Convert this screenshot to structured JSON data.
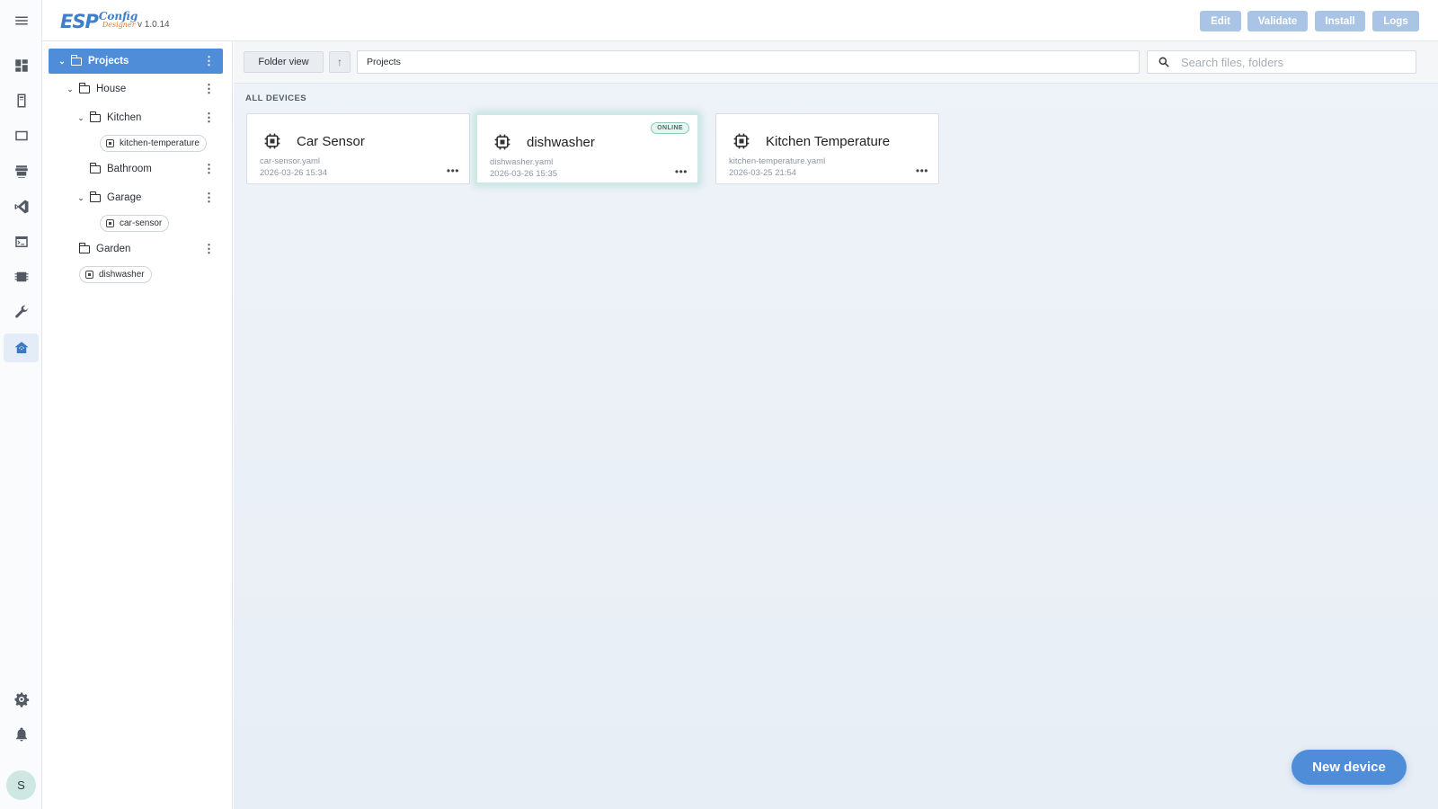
{
  "app": {
    "logo_main": "ESP",
    "logo_top": "Config",
    "logo_bottom": "Designer",
    "version": "v 1.0.14"
  },
  "header": {
    "buttons": [
      "Edit",
      "Validate",
      "Install",
      "Logs"
    ]
  },
  "rail": {
    "icons": [
      "menu-icon",
      "dashboard-icon",
      "device-icon",
      "media-icon",
      "hacs-icon",
      "vscode-icon",
      "terminal-icon",
      "esphome-icon",
      "wrench-icon",
      "home-icon",
      "settings-icon",
      "bell-icon"
    ],
    "active": "home-icon",
    "avatar_initial": "S"
  },
  "tree": {
    "root": "Projects",
    "house": "House",
    "kitchen": "Kitchen",
    "kitchen_device": "kitchen-temperature",
    "bathroom": "Bathroom",
    "garage": "Garage",
    "garage_device": "car-sensor",
    "garden": "Garden",
    "root_device": "dishwasher"
  },
  "toolbar": {
    "folder_view": "Folder view",
    "path": "Projects",
    "search_placeholder": "Search files, folders"
  },
  "main": {
    "section_label": "ALL DEVICES",
    "devices": [
      {
        "name": "Car Sensor",
        "file": "car-sensor.yaml",
        "date": "2026-03-26 15:34",
        "status": ""
      },
      {
        "name": "dishwasher",
        "file": "dishwasher.yaml",
        "date": "2026-03-26 15:35",
        "status": "ONLINE"
      },
      {
        "name": "Kitchen Temperature",
        "file": "kitchen-temperature.yaml",
        "date": "2026-03-25 21:54",
        "status": ""
      }
    ],
    "new_device": "New device"
  },
  "colors": {
    "accent": "#4f8dd8",
    "header_button": "#a9c4e4",
    "online_badge": "#8ec9bd",
    "logo_orange": "#e07a2c"
  }
}
